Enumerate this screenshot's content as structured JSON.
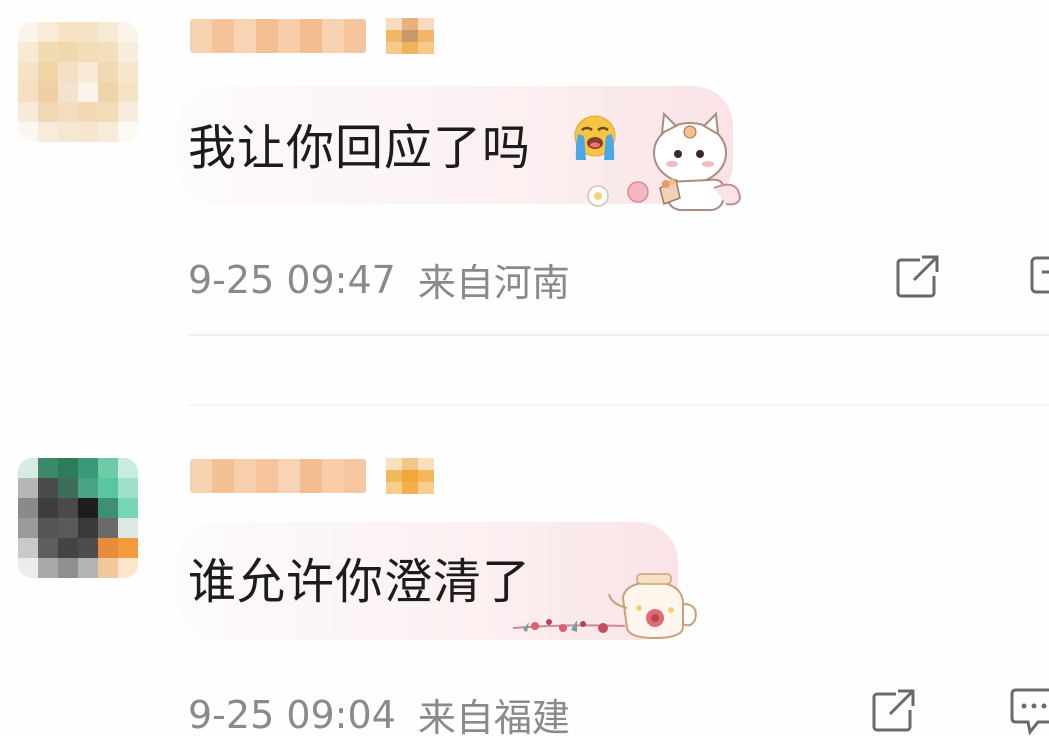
{
  "comments": [
    {
      "text": "我让你回应了吗",
      "timestamp": "9-25 09:47",
      "location": "来自河南",
      "emoji": "crying-face-icon",
      "sticker": "cat-sticker"
    },
    {
      "text": "谁允许你澄清了",
      "timestamp": "9-25 09:04",
      "location": "来自福建",
      "sticker": "teapot-flower-sticker"
    }
  ],
  "colors": {
    "text_primary": "#1c1c1c",
    "text_meta": "#8a8a8a",
    "bubble_pink": "#fae3e6",
    "name_blur_orange": "#f7c9a2",
    "badge_orange": "#f0b45a"
  }
}
